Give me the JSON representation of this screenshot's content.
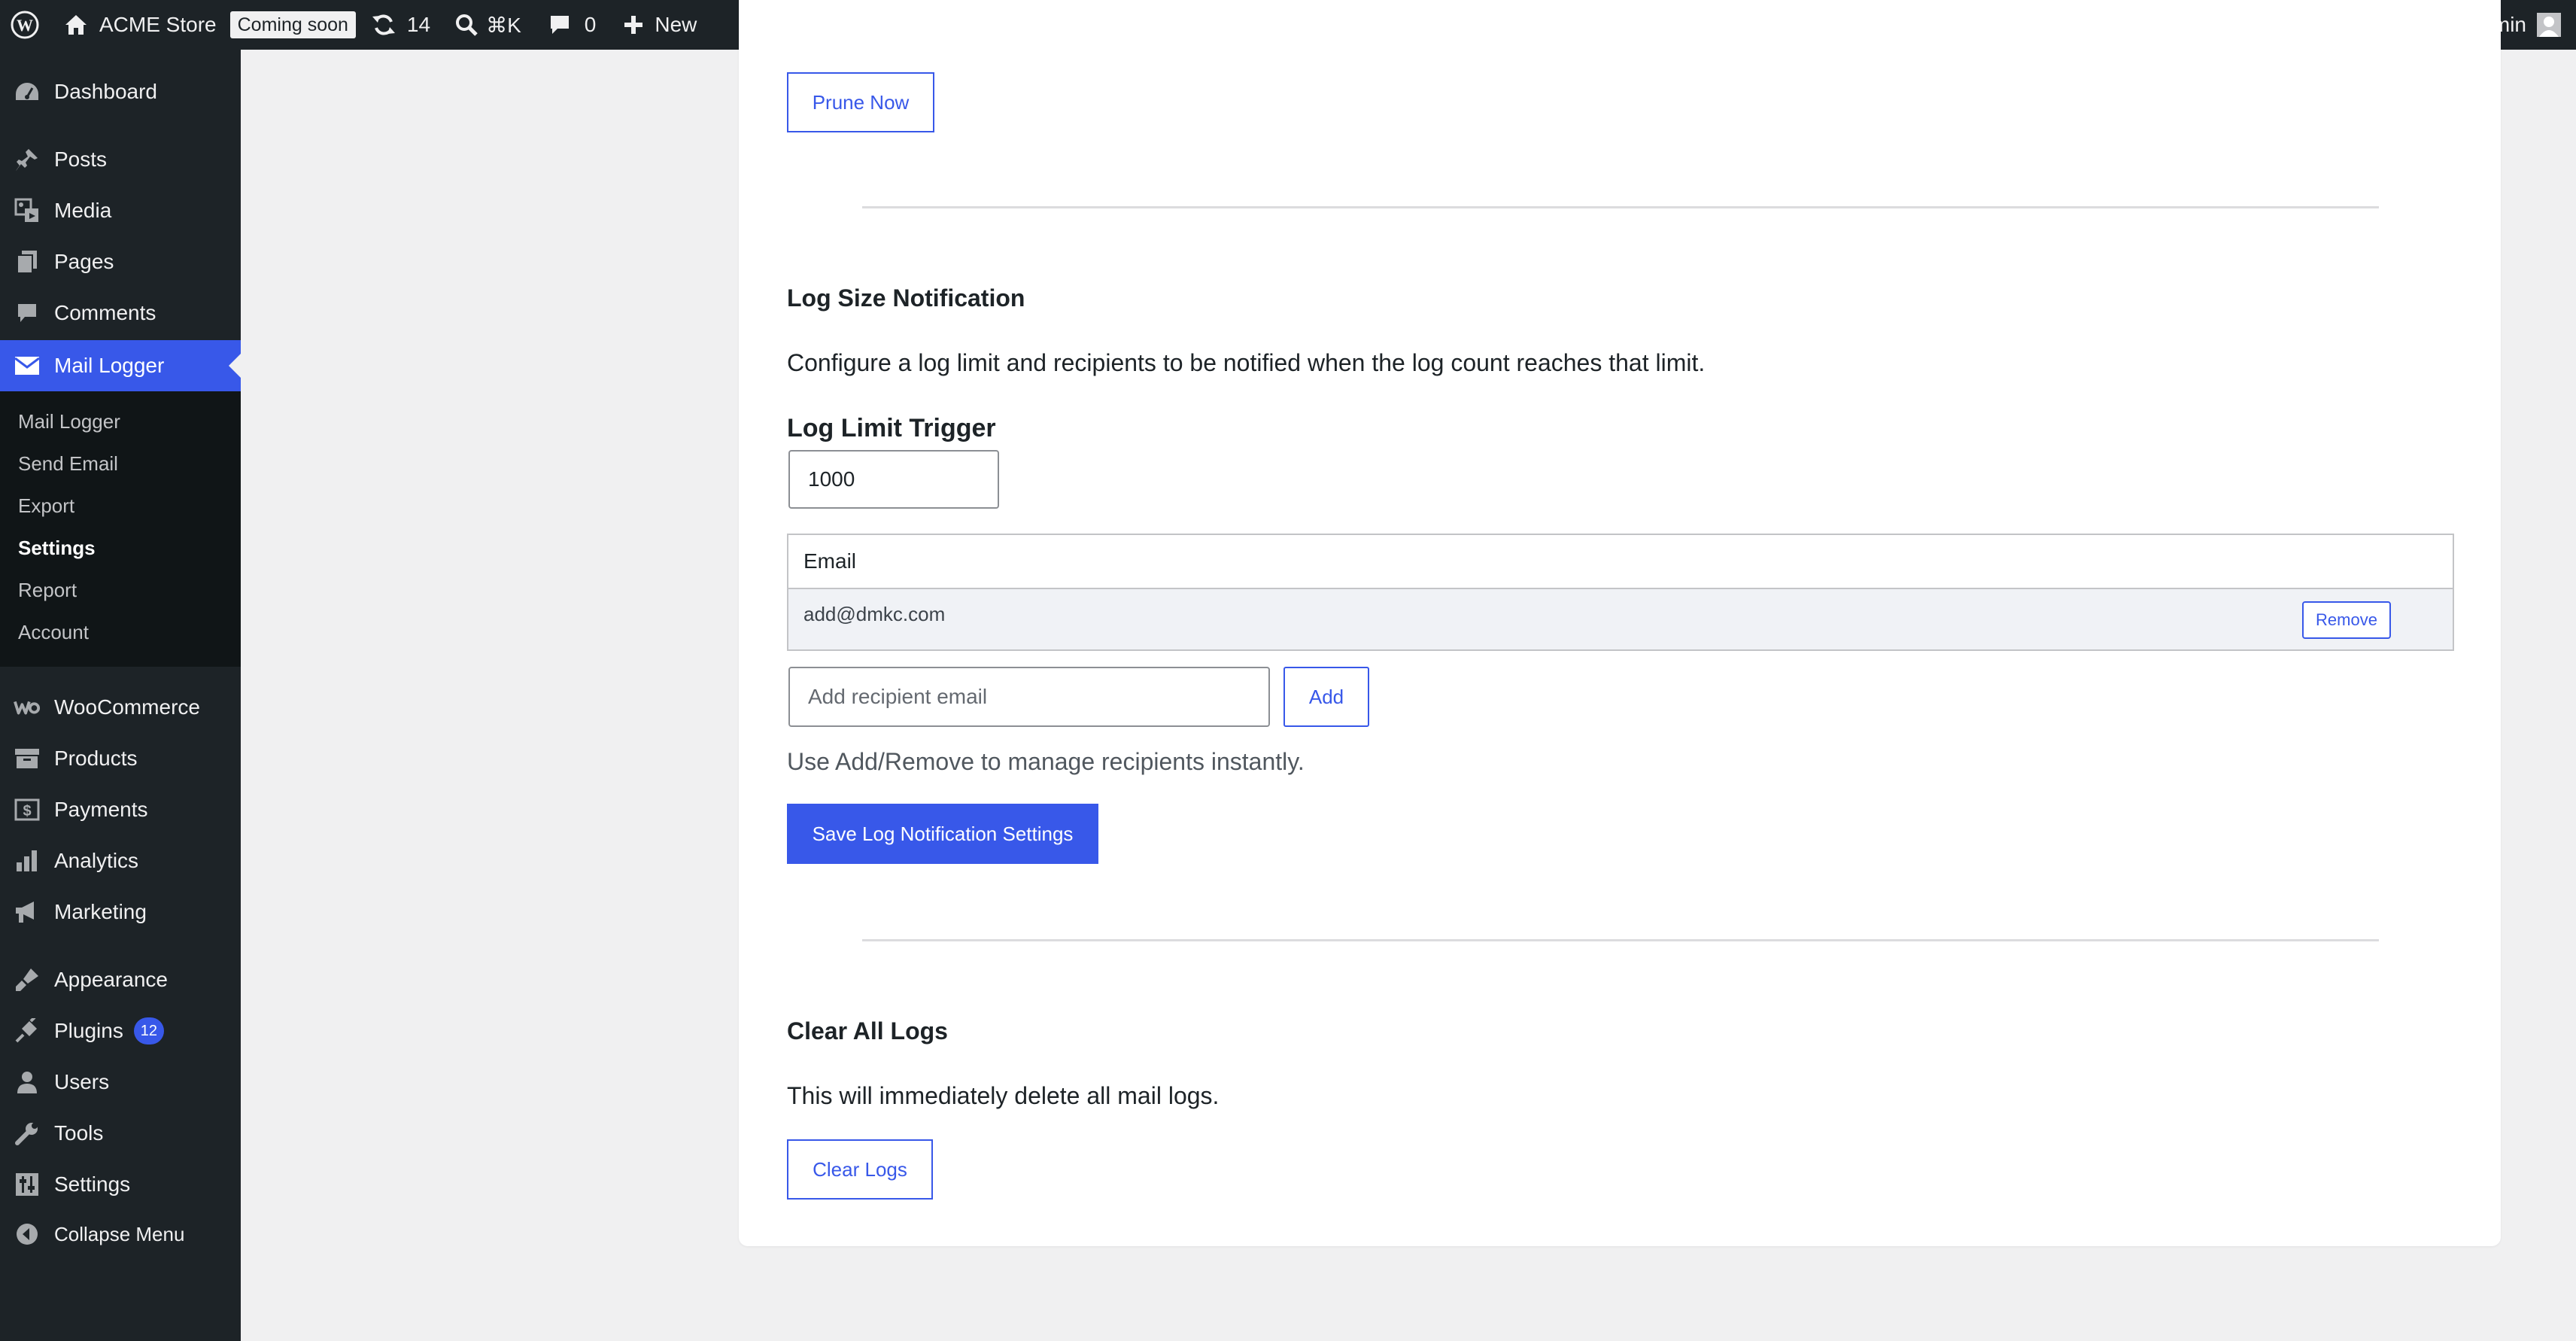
{
  "adminbar": {
    "site_name": "ACME Store",
    "coming_soon": "Coming soon",
    "updates_count": "14",
    "search_shortcut": "⌘K",
    "comments_count": "0",
    "new_label": "New",
    "greeting": "Hi, admin"
  },
  "sidebar": {
    "items": [
      {
        "label": "Dashboard",
        "icon": "dashboard-icon"
      },
      {
        "label": "Posts",
        "icon": "pin-icon"
      },
      {
        "label": "Media",
        "icon": "media-icon"
      },
      {
        "label": "Pages",
        "icon": "pages-icon"
      },
      {
        "label": "Comments",
        "icon": "comment-icon"
      },
      {
        "label": "Mail Logger",
        "icon": "mail-icon"
      },
      {
        "label": "WooCommerce",
        "icon": "woo-icon"
      },
      {
        "label": "Products",
        "icon": "archive-icon"
      },
      {
        "label": "Payments",
        "icon": "payments-icon"
      },
      {
        "label": "Analytics",
        "icon": "bar-chart-icon"
      },
      {
        "label": "Marketing",
        "icon": "megaphone-icon"
      },
      {
        "label": "Appearance",
        "icon": "brush-icon"
      },
      {
        "label": "Plugins",
        "icon": "plug-icon",
        "badge": "12"
      },
      {
        "label": "Users",
        "icon": "user-icon"
      },
      {
        "label": "Tools",
        "icon": "wrench-icon"
      },
      {
        "label": "Settings",
        "icon": "sliders-icon"
      },
      {
        "label": "Collapse Menu",
        "icon": "collapse-icon"
      }
    ],
    "submenu": [
      "Mail Logger",
      "Send Email",
      "Export",
      "Settings",
      "Report",
      "Account"
    ],
    "current_submenu": "Settings"
  },
  "main": {
    "prune_button": "Prune Now",
    "log_size": {
      "heading": "Log Size Notification",
      "description": "Configure a log limit and recipients to be notified when the log count reaches that limit.",
      "limit_label": "Log Limit Trigger",
      "limit_value": "1000",
      "table_header": "Email",
      "recipients": [
        {
          "email": "add@dmkc.com",
          "remove_label": "Remove"
        }
      ],
      "add_placeholder": "Add recipient email",
      "add_button": "Add",
      "help": "Use Add/Remove to manage recipients instantly.",
      "save_button": "Save Log Notification Settings"
    },
    "clear": {
      "heading": "Clear All Logs",
      "description": "This will immediately delete all mail logs.",
      "button": "Clear Logs"
    }
  },
  "colors": {
    "accent": "#3858e9",
    "sidebar_bg": "#1d2327",
    "submenu_bg": "#101517",
    "page_bg": "#f0f0f1"
  }
}
